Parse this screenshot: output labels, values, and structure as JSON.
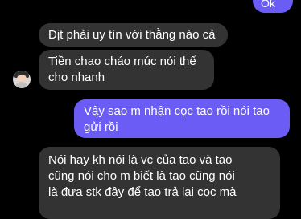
{
  "messages": [
    {
      "id": "m0",
      "side": "out",
      "text": "Ok"
    },
    {
      "id": "m1",
      "side": "in",
      "text": "Địt phải uy tín với thằng nào cả"
    },
    {
      "id": "m2",
      "side": "in",
      "lines": [
        "Tiền chao cháo múc nói thế",
        "cho nhanh"
      ]
    },
    {
      "id": "m3",
      "side": "out",
      "lines": [
        "Vậy sao m nhận cọc tao rồi nói tao",
        "gửi rồi"
      ]
    },
    {
      "id": "m4",
      "side": "in",
      "lines": [
        "Nói hay kh nói là vc của tao và tao",
        "cũng nói cho m biết là tao cũng nói",
        "là đưa stk đây để tao trả lại cọc mà"
      ]
    }
  ],
  "contact": {
    "avatar_icon": "user-avatar-icon"
  },
  "colors": {
    "outgoing": "#6a5cf5",
    "incoming": "#333334",
    "background": "#000000"
  }
}
